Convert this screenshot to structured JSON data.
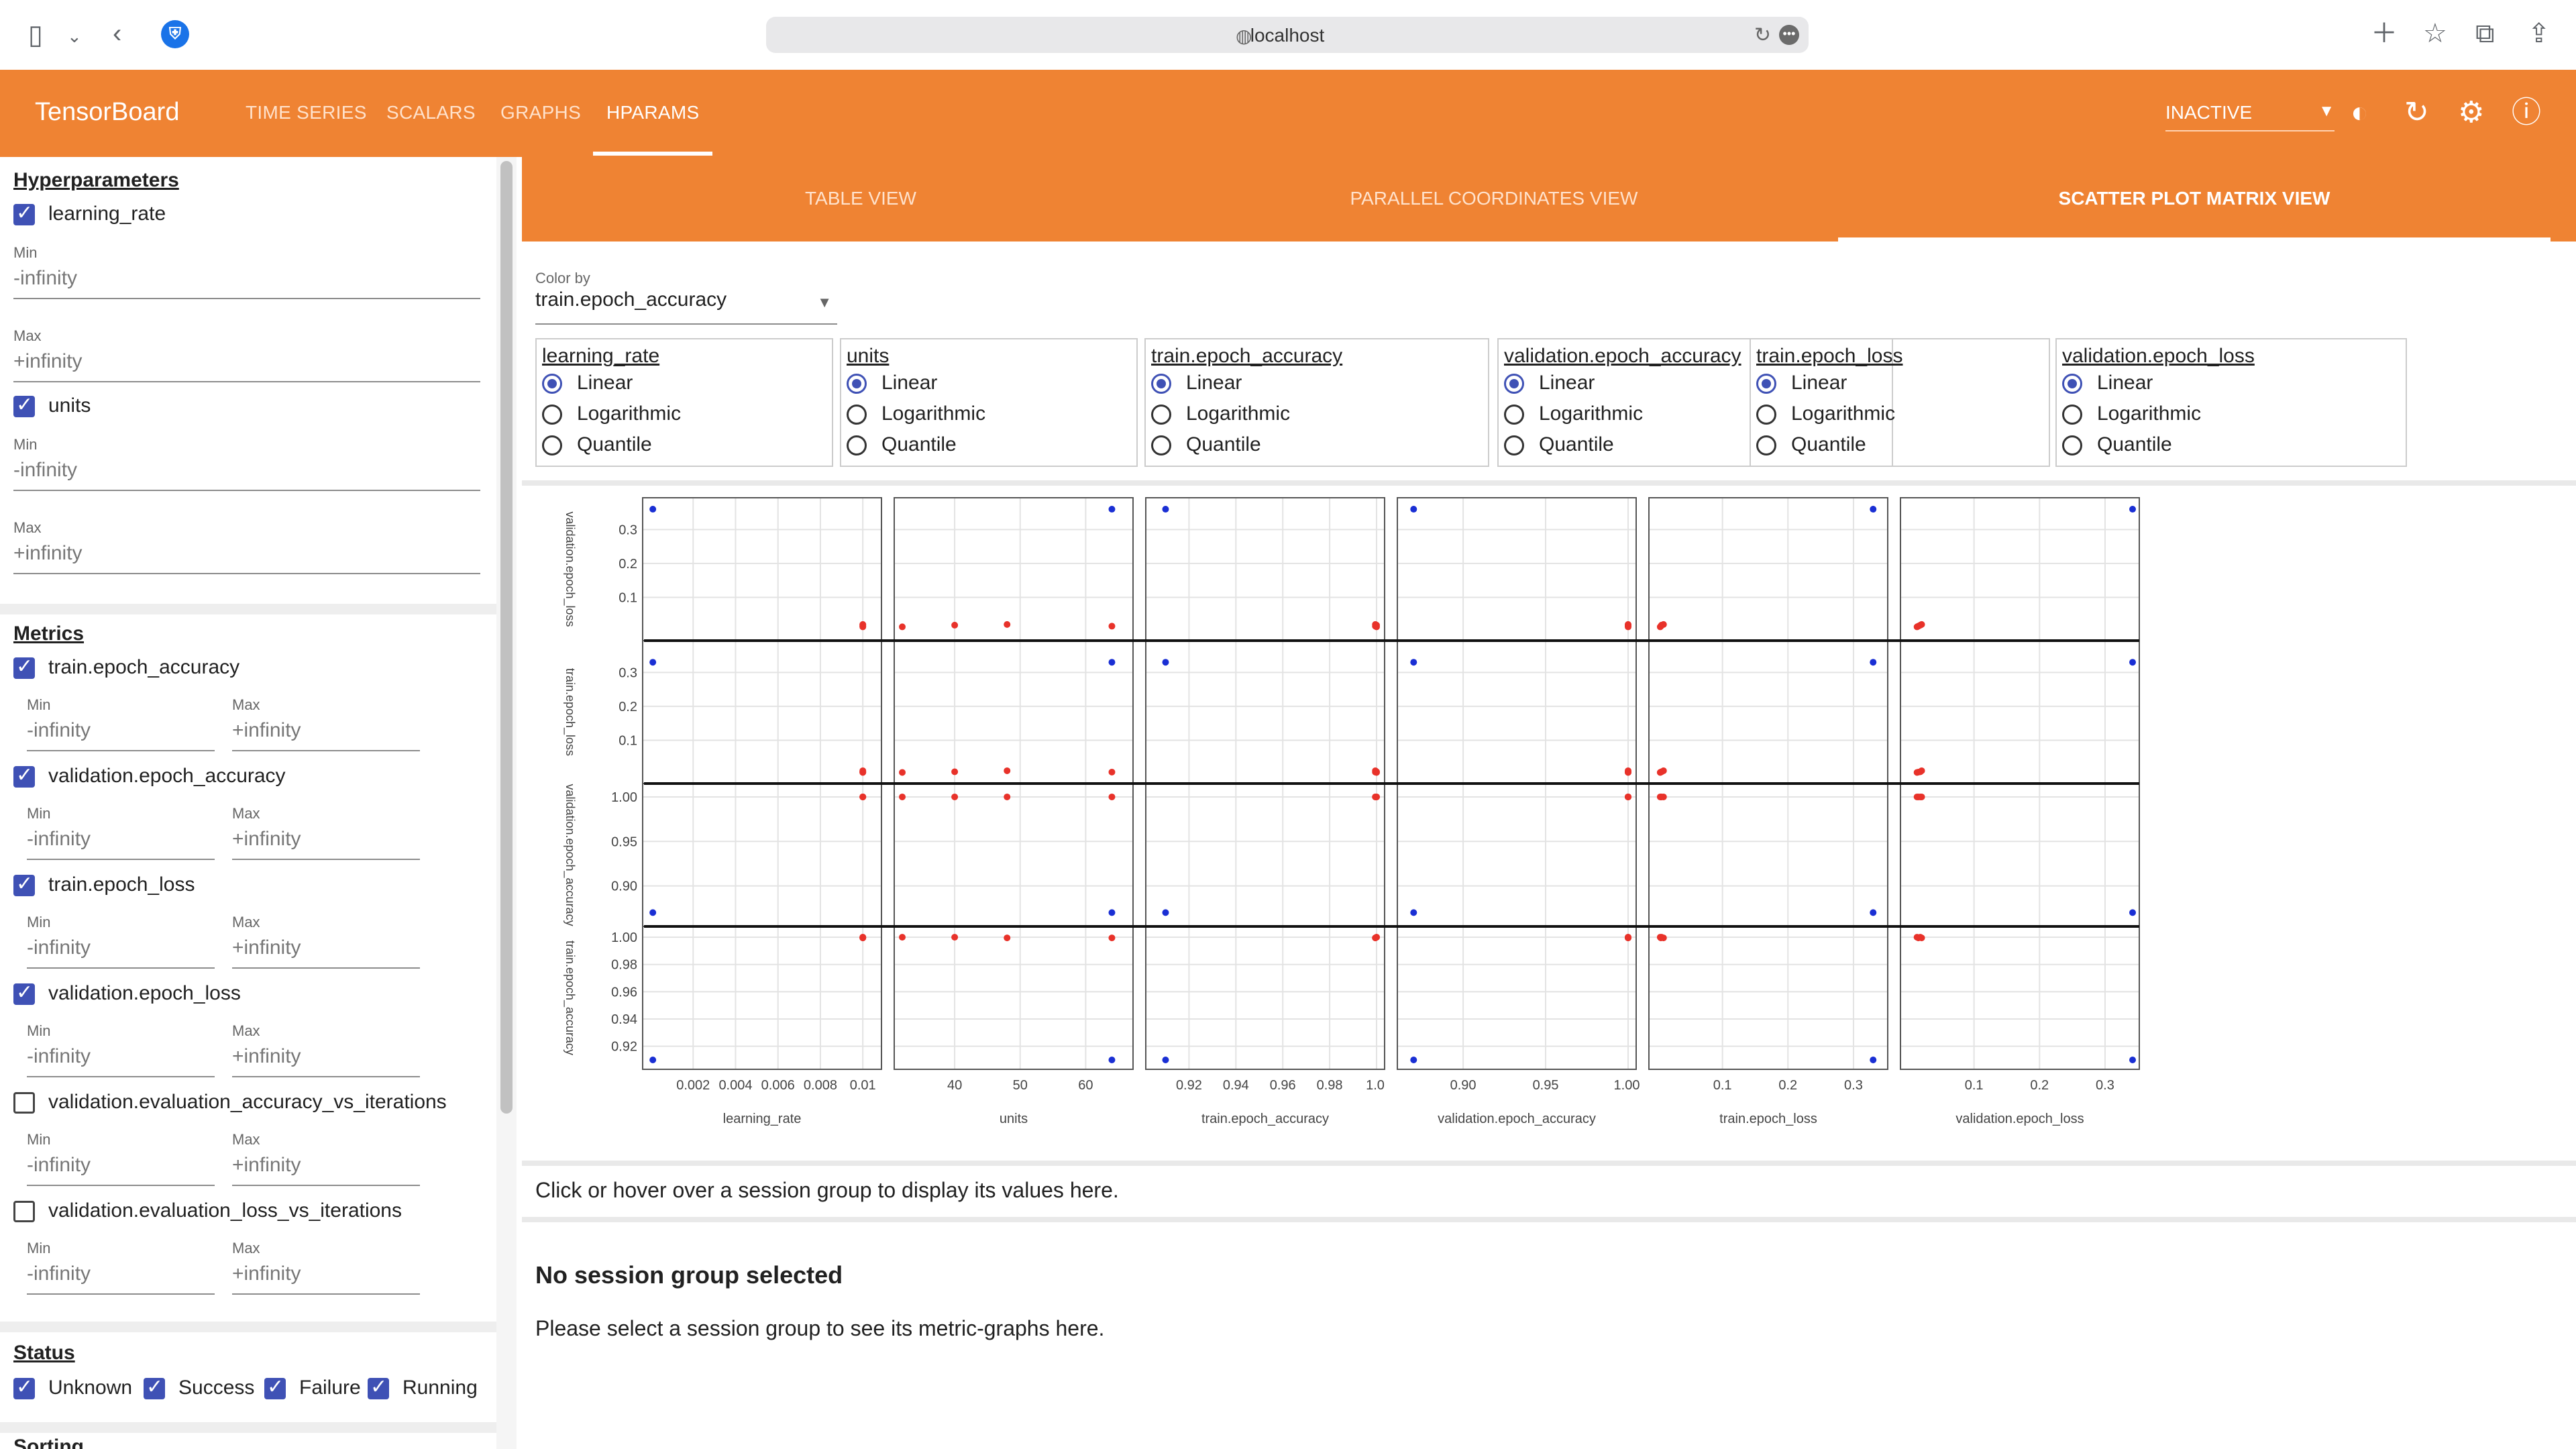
{
  "browser": {
    "url": "localhost",
    "icons": [
      "sidebar-icon",
      "chevron-down-icon",
      "back-icon",
      "bitwarden-icon",
      "globe-icon",
      "reload-icon",
      "more-icon",
      "new-tab-icon",
      "star-icon",
      "tabs-icon",
      "share-icon"
    ]
  },
  "app": {
    "brand": "TensorBoard",
    "nav": [
      "TIME SERIES",
      "SCALARS",
      "GRAPHS",
      "HPARAMS"
    ],
    "active_nav": "HPARAMS",
    "run_state": "INACTIVE"
  },
  "sidebar": {
    "hyperparameters_title": "Hyperparameters",
    "hparams": [
      {
        "name": "learning_rate",
        "checked": true,
        "min_label": "Min",
        "min": "-infinity",
        "max_label": "Max",
        "max": "+infinity"
      },
      {
        "name": "units",
        "checked": true,
        "min_label": "Min",
        "min": "-infinity",
        "max_label": "Max",
        "max": "+infinity"
      }
    ],
    "metrics_title": "Metrics",
    "metrics": [
      {
        "name": "train.epoch_accuracy",
        "checked": true,
        "min_label": "Min",
        "min": "-infinity",
        "max_label": "Max",
        "max": "+infinity"
      },
      {
        "name": "validation.epoch_accuracy",
        "checked": true,
        "min_label": "Min",
        "min": "-infinity",
        "max_label": "Max",
        "max": "+infinity"
      },
      {
        "name": "train.epoch_loss",
        "checked": true,
        "min_label": "Min",
        "min": "-infinity",
        "max_label": "Max",
        "max": "+infinity"
      },
      {
        "name": "validation.epoch_loss",
        "checked": true,
        "min_label": "Min",
        "min": "-infinity",
        "max_label": "Max",
        "max": "+infinity"
      },
      {
        "name": "validation.evaluation_accuracy_vs_iterations",
        "checked": false,
        "min_label": "Min",
        "min": "-infinity",
        "max_label": "Max",
        "max": "+infinity"
      },
      {
        "name": "validation.evaluation_loss_vs_iterations",
        "checked": false,
        "min_label": "Min",
        "min": "-infinity",
        "max_label": "Max",
        "max": "+infinity"
      }
    ],
    "status_title": "Status",
    "statuses": [
      {
        "label": "Unknown",
        "checked": true
      },
      {
        "label": "Success",
        "checked": true
      },
      {
        "label": "Failure",
        "checked": true
      },
      {
        "label": "Running",
        "checked": true
      }
    ],
    "sorting_title": "Sorting"
  },
  "main": {
    "tabs": [
      "TABLE VIEW",
      "PARALLEL COORDINATES VIEW",
      "SCATTER PLOT MATRIX VIEW"
    ],
    "active_tab": "SCATTER PLOT MATRIX VIEW",
    "color_by_label": "Color by",
    "color_by_value": "train.epoch_accuracy",
    "scale_columns": [
      {
        "name": "learning_rate",
        "selected": "Linear"
      },
      {
        "name": "units",
        "selected": "Linear"
      },
      {
        "name": "train.epoch_accuracy",
        "selected": "Linear"
      },
      {
        "name": "validation.epoch_accuracy",
        "selected": "Linear"
      },
      {
        "name": "train.epoch_loss",
        "selected": "Linear"
      },
      {
        "name": "validation.epoch_loss",
        "selected": "Linear"
      }
    ],
    "scale_options": [
      "Linear",
      "Logarithmic",
      "Quantile"
    ],
    "hover_hint": "Click or hover over a session group to display its values here.",
    "no_selection_title": "No session group selected",
    "no_selection_text": "Please select a session group to see its metric-graphs here."
  },
  "chart_data": {
    "type": "scatter",
    "columns": [
      {
        "name": "learning_rate",
        "ticks": [
          "0.002",
          "0.004",
          "0.006",
          "0.008",
          "0.01"
        ],
        "range": [
          0.0,
          0.0105
        ]
      },
      {
        "name": "units",
        "ticks": [
          "40",
          "50",
          "60"
        ],
        "range": [
          32,
          66
        ]
      },
      {
        "name": "train.epoch_accuracy",
        "ticks": [
          "0.92",
          "0.94",
          "0.96",
          "0.98",
          "1.0"
        ],
        "range": [
          0.905,
          1.0
        ]
      },
      {
        "name": "validation.epoch_accuracy",
        "ticks": [
          "0.90",
          "0.95",
          "1.00"
        ],
        "range": [
          0.865,
          1.0
        ]
      },
      {
        "name": "train.epoch_loss",
        "ticks": [
          "0.1",
          "0.2",
          "0.3"
        ],
        "range": [
          0.0,
          0.34
        ]
      },
      {
        "name": "validation.epoch_loss",
        "ticks": [
          "0.1",
          "0.2",
          "0.3"
        ],
        "range": [
          0.0,
          0.34
        ]
      }
    ],
    "rows": [
      {
        "name": "validation.epoch_loss",
        "ticks": [
          "0.1",
          "0.2",
          "0.3"
        ],
        "range": [
          0.0,
          0.37
        ]
      },
      {
        "name": "train.epoch_loss",
        "ticks": [
          "0.1",
          "0.2",
          "0.3"
        ],
        "range": [
          0.0,
          0.37
        ]
      },
      {
        "name": "validation.epoch_accuracy",
        "ticks": [
          "0.90",
          "0.95",
          "1.00"
        ],
        "range": [
          0.865,
          1.006
        ]
      },
      {
        "name": "train.epoch_accuracy",
        "ticks": [
          "0.92",
          "0.94",
          "0.96",
          "0.98",
          "1.00"
        ],
        "range": [
          0.91,
          1.002
        ]
      }
    ],
    "color_scale": {
      "low": "#1a2fd4",
      "high": "#e8322a"
    },
    "sessions": [
      {
        "learning_rate": 0.0001,
        "units": 64,
        "train.epoch_accuracy": 0.91,
        "validation.epoch_accuracy": 0.87,
        "train.epoch_loss": 0.33,
        "validation.epoch_loss": 0.36
      },
      {
        "learning_rate": 0.01,
        "units": 32,
        "train.epoch_accuracy": 1.0,
        "validation.epoch_accuracy": 1.0,
        "train.epoch_loss": 0.005,
        "validation.epoch_loss": 0.013
      },
      {
        "learning_rate": 0.01,
        "units": 40,
        "train.epoch_accuracy": 1.0,
        "validation.epoch_accuracy": 1.0,
        "train.epoch_loss": 0.007,
        "validation.epoch_loss": 0.018
      },
      {
        "learning_rate": 0.01,
        "units": 48,
        "train.epoch_accuracy": 0.9995,
        "validation.epoch_accuracy": 1.0,
        "train.epoch_loss": 0.01,
        "validation.epoch_loss": 0.02
      },
      {
        "learning_rate": 0.01,
        "units": 64,
        "train.epoch_accuracy": 0.9995,
        "validation.epoch_accuracy": 1.0,
        "train.epoch_loss": 0.006,
        "validation.epoch_loss": 0.015
      }
    ]
  }
}
